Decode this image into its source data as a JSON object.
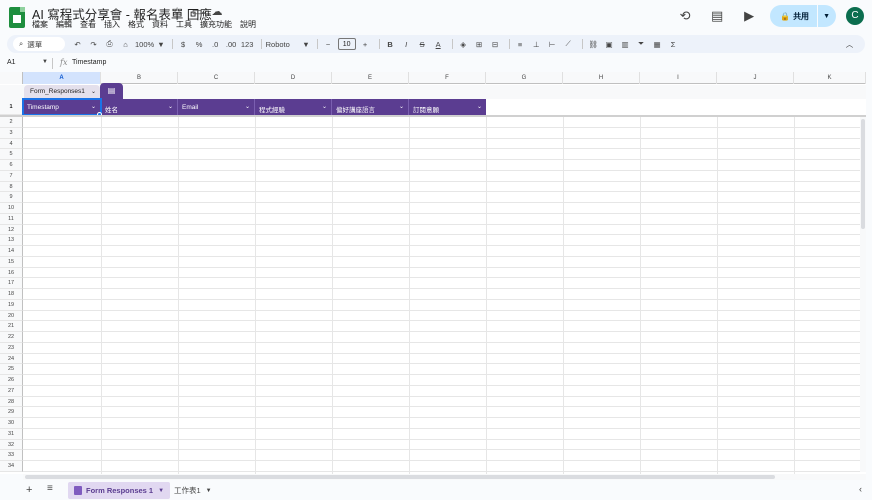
{
  "document": {
    "title": "AI 寫程式分享會 - 報名表單 回應",
    "menu": [
      "檔案",
      "編輯",
      "查看",
      "插入",
      "格式",
      "資料",
      "工具",
      "擴充功能",
      "說明"
    ]
  },
  "header_actions": {
    "share_label": "共用",
    "avatar_letter": "C"
  },
  "toolbar": {
    "search_label": "選單",
    "zoom": "100%",
    "currency": "$",
    "percent": "%",
    "decrease_decimal": ".0",
    "increase_decimal": ".00",
    "number_format": "123",
    "font_name": "Roboto",
    "font_size": "10",
    "bold": "B",
    "italic": "I",
    "strike": "S",
    "text_color": "A",
    "sum": "Σ"
  },
  "formula_bar": {
    "cell_ref": "A1",
    "fx": "fx",
    "value": "Timestamp"
  },
  "columns": [
    "A",
    "B",
    "C",
    "D",
    "E",
    "F",
    "G",
    "H",
    "I",
    "J",
    "K"
  ],
  "rows": [
    "1",
    "2",
    "3",
    "4",
    "5",
    "6",
    "7",
    "8",
    "9",
    "10",
    "11",
    "12",
    "13",
    "14",
    "15",
    "16",
    "17",
    "18",
    "19",
    "20",
    "21",
    "22",
    "23",
    "24",
    "25",
    "26",
    "27",
    "28",
    "29",
    "30",
    "31",
    "32",
    "33",
    "34"
  ],
  "table": {
    "name": "Form_Responses1",
    "headers": [
      "Timestamp",
      "姓名",
      "Email",
      "程式經驗",
      "偏好講座語言",
      "訂閱意願"
    ],
    "accent_color": "#5b3d91"
  },
  "sheets": [
    {
      "name": "Form Responses 1",
      "active": true
    },
    {
      "name": "工作表1",
      "active": false
    }
  ]
}
